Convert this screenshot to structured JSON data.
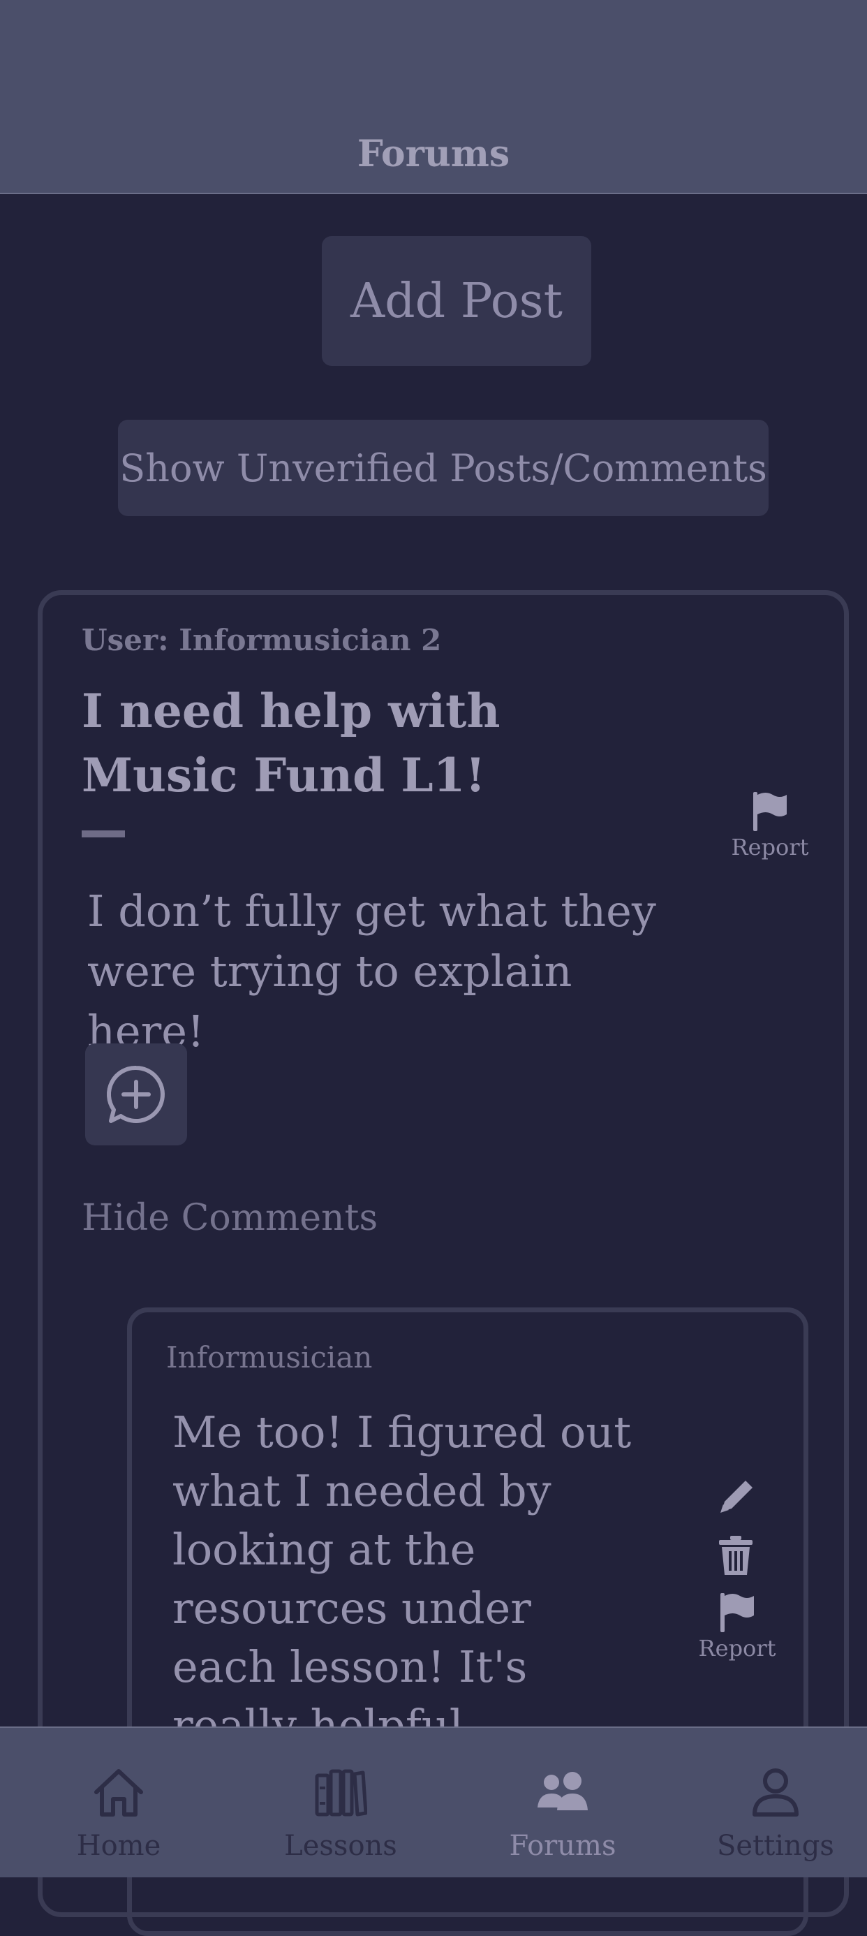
{
  "header": {
    "title": "Forums"
  },
  "actions": {
    "add_post": "Add Post",
    "show_unverified": "Show Unverified Posts/Comments"
  },
  "post": {
    "user": "User: Informusician 2",
    "title": "I need help with Music Fund L1!",
    "body": "I don’t fully get what they were trying to explain here!",
    "report_label": "Report",
    "add_comment_icon": "comment-add-icon",
    "hide_comments": "Hide Comments"
  },
  "comment": {
    "user": "Informusician",
    "body": "Me too! I figured out what I needed by looking at the resources under each lesson! It's really helpful",
    "report_label": "Report",
    "icons": [
      "pencil-icon",
      "trash-icon",
      "flag-icon"
    ]
  },
  "nav": {
    "items": [
      {
        "label": "Home",
        "icon": "home-icon",
        "active": false
      },
      {
        "label": "Lessons",
        "icon": "books-icon",
        "active": false
      },
      {
        "label": "Forums",
        "icon": "people-icon",
        "active": true
      },
      {
        "label": "Settings",
        "icon": "user-icon",
        "active": false
      }
    ]
  },
  "colors": {
    "background": "#22223a",
    "bars": "#4b4f6a",
    "button": "#34354f",
    "text": "#8f8ca9",
    "inactive_nav": "#2d2d46"
  }
}
